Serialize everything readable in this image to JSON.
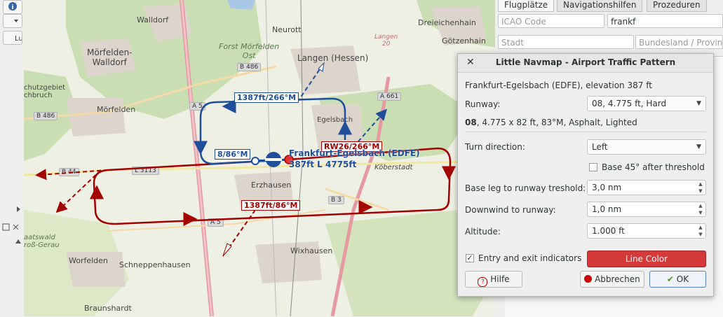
{
  "map": {
    "labels": {
      "walldorf": "Walldorf",
      "neurott": "Neurott",
      "dreieichenhain": "Dreieichenhain",
      "goetzenhain": "Götzenhain",
      "moerfelden_walldorf": "Mörfelden-\nWalldorf",
      "forst": "Forst Mörfelden\nOst",
      "langen": "Langen (Hessen)",
      "langen20": "Langen\n20",
      "schutzgebiet": "chutzgebiet\nchbruch",
      "moerfelden": "Mörfelden",
      "egelsbach": "Egelsbach",
      "koeberstadt": "Köberstadt",
      "erzhausen": "Erzhausen",
      "wixhausen": "Wixhausen",
      "worfelden": "Worfelden",
      "schneppenhausen": "Schneppenhausen",
      "braunshardt": "Braunshardt",
      "staatswald": "aatswald\nroß-Gerau"
    },
    "roads": {
      "b486a": "B 486",
      "b486b": "B 486",
      "a5a": "A 5",
      "a5b": "A 5",
      "a661": "A 661",
      "b44": "B 44",
      "l3113": "L 3113",
      "b3": "B 3"
    },
    "pattern": {
      "blue_downwind": "1387ft/266°M",
      "blue_final": "8/86°M",
      "red_runway": "RW26/266°M",
      "red_downwind": "1387ft/86°M",
      "airport_name": "Frankfurt-Egelsbach (EDFE)",
      "airport_info": "387ft L 4775ft"
    },
    "colors": {
      "red_pattern": "#a40000",
      "blue_pattern": "#1f4f9a"
    }
  },
  "right_panel": {
    "tabs": [
      "Flugplätze",
      "Navigationshilfen",
      "Prozeduren"
    ],
    "icao_placeholder": "ICAO Code",
    "name_value": "frankf",
    "city_placeholder": "Stadt",
    "state_placeholder": "Bundesland / Provinz"
  },
  "dialog": {
    "title": "Little Navmap - Airport Traffic Pattern",
    "airport_line": "Frankfurt-Egelsbach (EDFE), elevation 387 ft",
    "runway_label": "Runway:",
    "runway_value": "08, 4.775 ft, Hard",
    "runway_detail_bold": "08",
    "runway_detail_rest": ", 4.775 x 82 ft, 83°M, Asphalt, Lighted",
    "turn_label": "Turn direction:",
    "turn_value": "Left",
    "base45_label": "Base 45° after threshold",
    "base45_checked": false,
    "baseleg_label": "Base leg to runway treshold:",
    "baseleg_value": "3,0 nm",
    "downwind_label": "Downwind to runway:",
    "downwind_value": "1,0 nm",
    "altitude_label": "Altitude:",
    "altitude_value": "1.000 ft",
    "entry_exit_label": "Entry and exit indicators",
    "entry_exit_checked": true,
    "line_color_label": "Line Color",
    "line_color": "#d43a3a",
    "help_label": "Hilfe",
    "cancel_label": "Abbrechen",
    "ok_label": "OK"
  }
}
